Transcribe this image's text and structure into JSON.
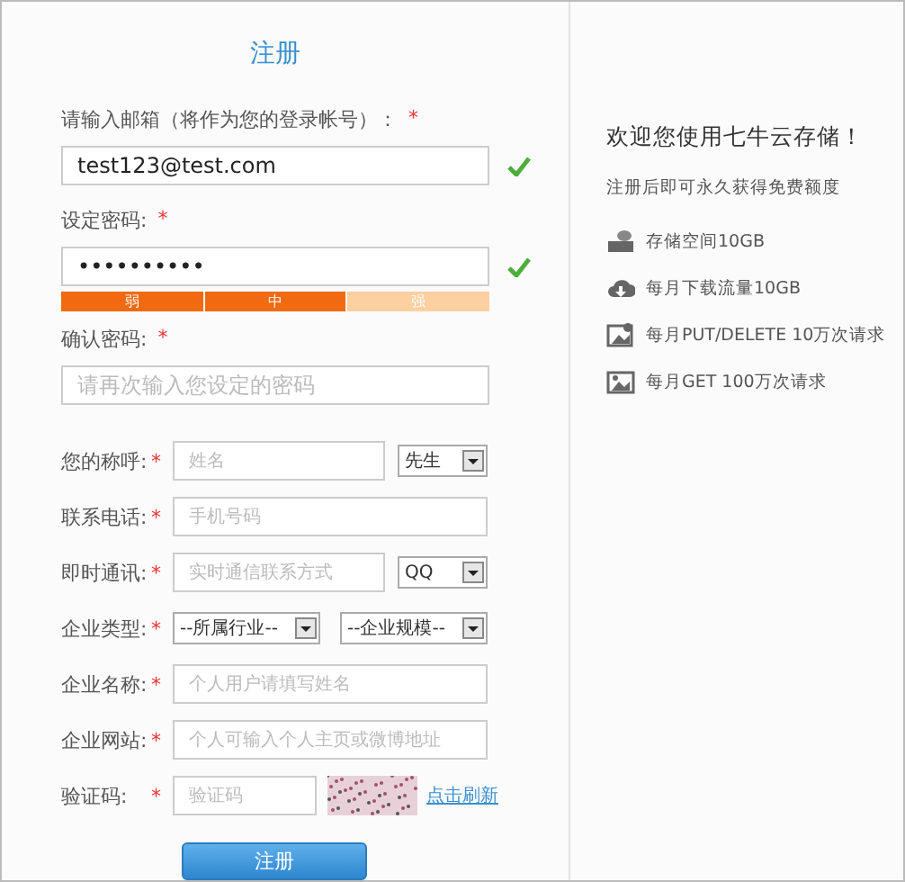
{
  "title": "注册",
  "top_fields": [
    {
      "label": "请输入邮箱（将作为您的登录帐号）：",
      "mark": "*",
      "value": "test123@test.com",
      "valid": true
    },
    {
      "label": "设定密码:",
      "mark": "*",
      "value": "••••••••••",
      "valid": true,
      "strength": [
        {
          "label": "弱",
          "active": true
        },
        {
          "label": "中",
          "active": true
        },
        {
          "label": "强",
          "active": false
        }
      ]
    },
    {
      "label": "确认密码:",
      "mark": "*",
      "placeholder": "请再次输入您设定的密码",
      "valid": false
    }
  ],
  "rows": [
    {
      "kind": "input_select",
      "label": "您的称呼:",
      "mark": "*",
      "placeholder": "姓名",
      "select": "先生"
    },
    {
      "kind": "input",
      "label": "联系电话:",
      "mark": "*",
      "placeholder": "手机号码"
    },
    {
      "kind": "input_select",
      "label": "即时通讯:",
      "mark": "*",
      "placeholder": "实时通信联系方式",
      "select": "QQ"
    },
    {
      "kind": "double_select",
      "label": "企业类型:",
      "mark": "*",
      "select": "--所属行业--",
      "select2": "--企业规模--"
    },
    {
      "kind": "input",
      "label": "企业名称:",
      "mark": "*",
      "placeholder": "个人用户请填写姓名"
    },
    {
      "kind": "input",
      "label": "企业网站:",
      "mark": "*",
      "placeholder": "个人可输入个人主页或微博地址"
    },
    {
      "kind": "captcha",
      "label": "验证码:",
      "mark": "*",
      "placeholder": "验证码",
      "link": "点击刷新"
    }
  ],
  "submit": "注册",
  "side": {
    "heading": "欢迎您使用七牛云存储！",
    "subtitle": "注册后即可永久获得免费额度",
    "items": [
      {
        "text": "存储空间10GB"
      },
      {
        "text": "每月下载流量10GB"
      },
      {
        "text": "每月PUT/DELETE 10万次请求"
      },
      {
        "text": "每月GET 100万次请求"
      }
    ]
  }
}
